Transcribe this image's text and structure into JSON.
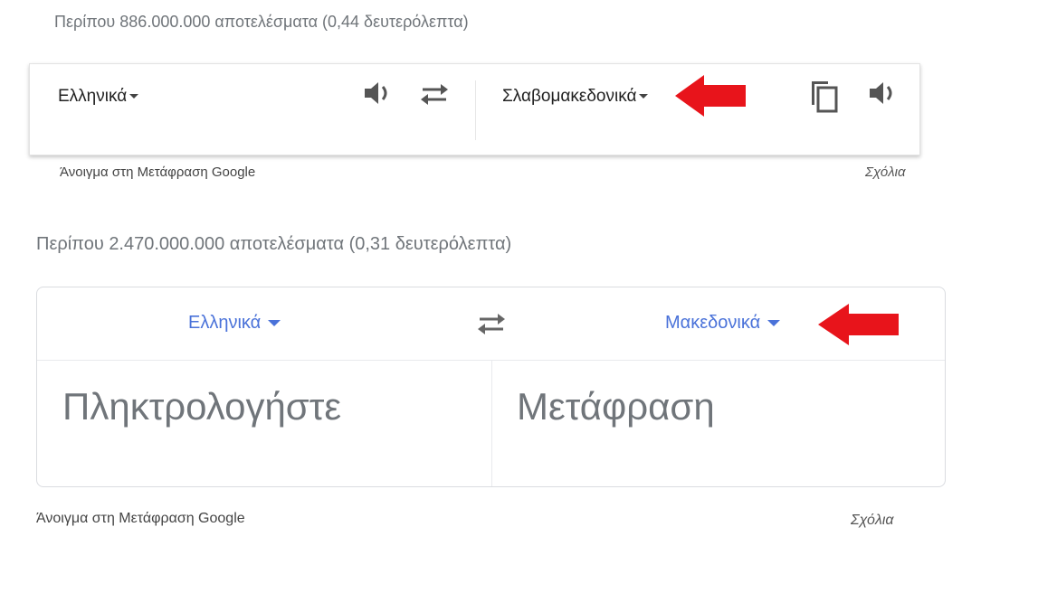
{
  "results_top": {
    "stats": "Περίπου 886.000.000 αποτελέσματα (0,44 δευτερόλεπτα)"
  },
  "old_widget": {
    "source_lang": "Ελληνικά",
    "target_lang": "Σλαβομακεδονικά",
    "icons": [
      "speaker-icon",
      "swap-icon",
      "copy-icon",
      "speaker-icon"
    ],
    "footer_open": "Άνοιγμα στη Μετάφραση Google",
    "footer_feedback": "Σχόλια"
  },
  "results_bottom": {
    "stats": "Περίπου 2.470.000.000 αποτελέσματα (0,31 δευτερόλεπτα)"
  },
  "new_widget": {
    "source_lang": "Ελληνικά",
    "target_lang": "Μακεδονικά",
    "input_placeholder": "Πληκτρολογήστε",
    "output_text": "Μετάφραση",
    "footer_open": "Άνοιγμα στη Μετάφραση Google",
    "footer_feedback": "Σχόλια",
    "accent_color": "#4a72d9"
  },
  "annotation": {
    "arrow_color": "#e8141b"
  }
}
